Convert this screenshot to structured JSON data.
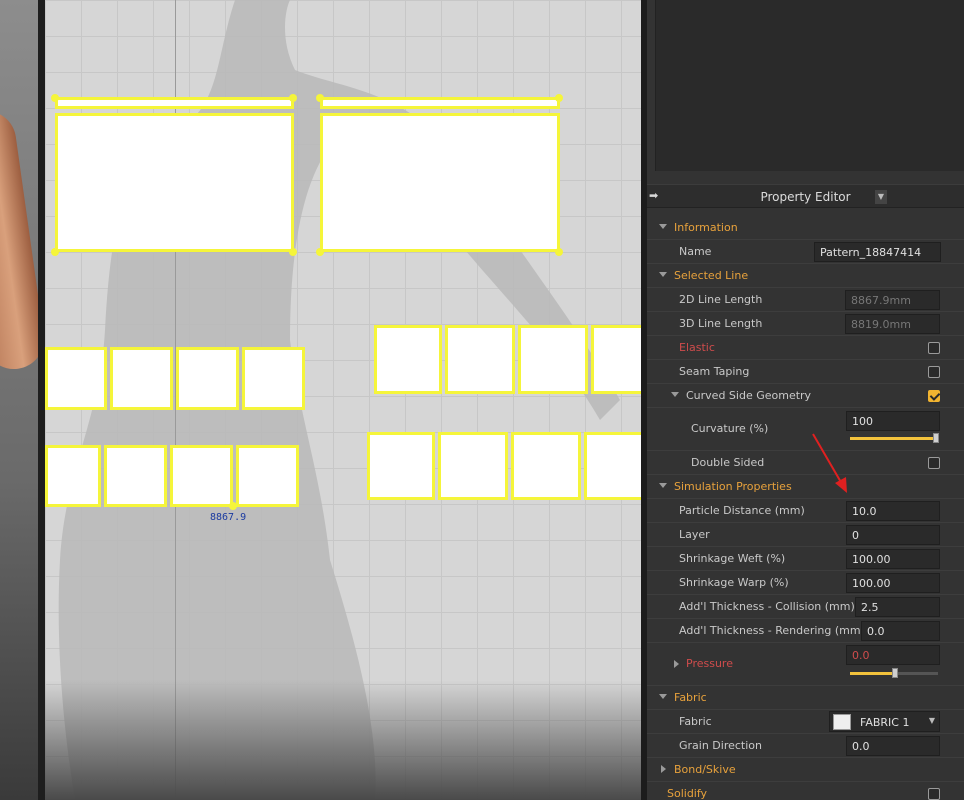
{
  "panel": {
    "title": "Property Editor",
    "pin_icon": "pin-icon",
    "dropdown_icon": "chevron-down-icon"
  },
  "pattern": {
    "measure_label": "8867.9"
  },
  "information": {
    "header": "Information",
    "name_label": "Name",
    "name_value": "Pattern_18847414"
  },
  "selected_line": {
    "header": "Selected Line",
    "line2d_label": "2D Line Length",
    "line2d_value": "8867.9mm",
    "line3d_label": "3D Line Length",
    "line3d_value": "8819.0mm",
    "elastic_label": "Elastic",
    "elastic_checked": false,
    "seam_taping_label": "Seam Taping",
    "seam_taping_checked": false,
    "curved_label": "Curved Side Geometry",
    "curved_checked": true,
    "curvature_label": "Curvature (%)",
    "curvature_value": "100",
    "curvature_level": 1.0,
    "double_sided_label": "Double Sided",
    "double_sided_checked": false
  },
  "simulation": {
    "header": "Simulation Properties",
    "particle_label": "Particle Distance (mm)",
    "particle_value": "10.0",
    "layer_label": "Layer",
    "layer_value": "0",
    "weft_label": "Shrinkage Weft (%)",
    "weft_value": "100.00",
    "warp_label": "Shrinkage Warp (%)",
    "warp_value": "100.00",
    "collision_label": "Add'l Thickness - Collision (mm)",
    "collision_value": "2.5",
    "rendering_label": "Add'l Thickness - Rendering (mm)",
    "rendering_value": "0.0",
    "pressure_label": "Pressure",
    "pressure_value": "0.0",
    "pressure_level": 0.5
  },
  "fabric": {
    "header": "Fabric",
    "fabric_label": "Fabric",
    "fabric_value": "FABRIC 1",
    "grain_label": "Grain Direction",
    "grain_value": "0.0"
  },
  "bond": {
    "header": "Bond/Skive"
  },
  "solidify": {
    "label": "Solidify"
  },
  "colors": {
    "accent": "#e8a23c",
    "pattern_outline": "#f5f53a",
    "warning_red": "#cf4c4c",
    "annotation_arrow": "#e02020"
  }
}
